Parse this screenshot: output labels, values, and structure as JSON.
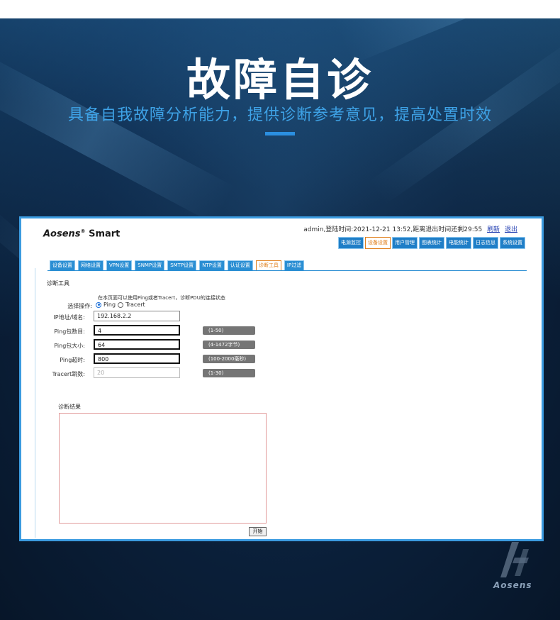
{
  "hero": {
    "title": "故障自诊",
    "subtitle": "具备自我故障分析能力，提供诊断参考意见，提高处置时效"
  },
  "app": {
    "logo_brand": "Aosens",
    "logo_reg": "®",
    "logo_product": "Smart",
    "userinfo": "admin,登陆时间:2021-12-21 13:52,距离退出时间还剩29:55",
    "refresh_link": "刷新",
    "logout_link": "退出"
  },
  "topnav": [
    {
      "label": "电源监控",
      "active": false
    },
    {
      "label": "设备设置",
      "active": true
    },
    {
      "label": "用户管理",
      "active": false
    },
    {
      "label": "图表统计",
      "active": false
    },
    {
      "label": "电能统计",
      "active": false
    },
    {
      "label": "日志信息",
      "active": false
    },
    {
      "label": "系统设置",
      "active": false
    }
  ],
  "tabs": [
    {
      "label": "设备设置",
      "active": false
    },
    {
      "label": "网络设置",
      "active": false
    },
    {
      "label": "VPN设置",
      "active": false
    },
    {
      "label": "SNMP设置",
      "active": false
    },
    {
      "label": "SMTP设置",
      "active": false
    },
    {
      "label": "NTP设置",
      "active": false
    },
    {
      "label": "认证设置",
      "active": false
    },
    {
      "label": "诊断工具",
      "active": true
    },
    {
      "label": "IP过滤",
      "active": false
    }
  ],
  "tool": {
    "section_title": "诊断工具",
    "description": "在本页面可以使用Ping或者Tracert，诊断PDU的连接状态",
    "op_label": "选择操作:",
    "radio_ping": "Ping",
    "radio_tracert": "Tracert",
    "selected": "Ping",
    "ip_label": "IP地址/域名:",
    "ip_value": "192.168.2.2",
    "ping_count_label": "Ping包数目:",
    "ping_count_value": "4",
    "ping_count_hint": "(1-50)",
    "ping_size_label": "Ping包大小:",
    "ping_size_value": "64",
    "ping_size_hint": "(4-1472字节)",
    "ping_timeout_label": "Ping超时:",
    "ping_timeout_value": "800",
    "ping_timeout_hint": "(100-2000毫秒)",
    "tracert_label": "Tracert跳数:",
    "tracert_value": "20",
    "tracert_hint": "(1-30)",
    "result_label": "诊断结果",
    "start_button": "开始"
  },
  "footer": {
    "corner_brand": "Aosens"
  },
  "colors": {
    "accent": "#3b9be0",
    "tab_blue": "#2a8ed3",
    "active_orange": "#e07e1a",
    "hero_dark": "#0c2340"
  }
}
